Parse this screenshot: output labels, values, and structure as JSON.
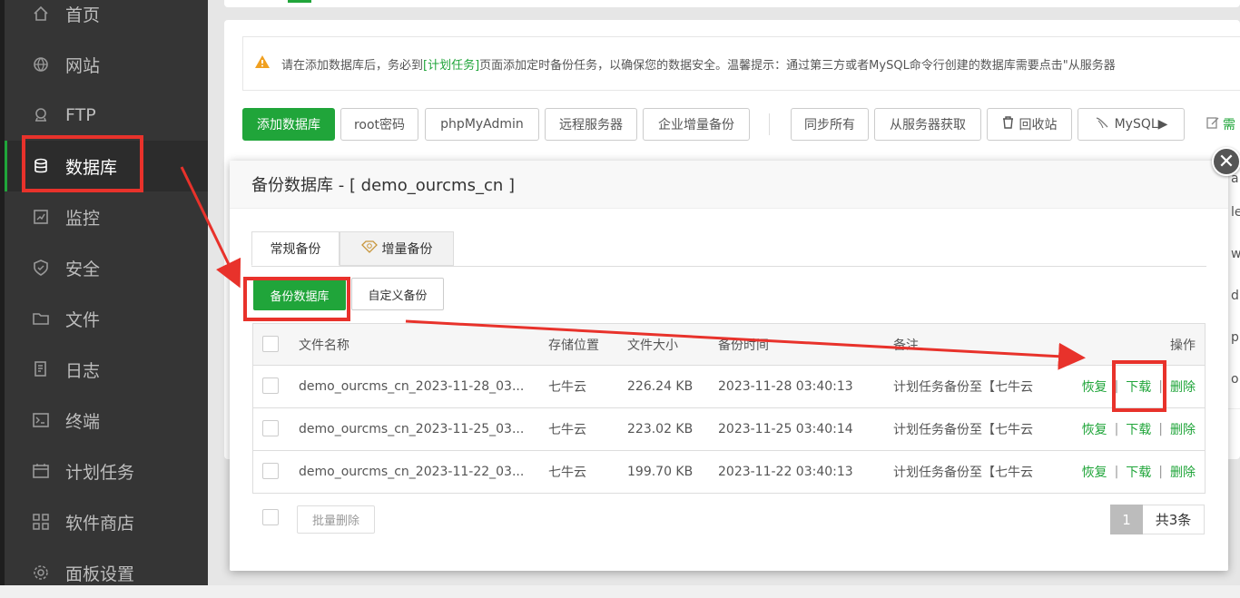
{
  "sidebar": {
    "items": [
      {
        "label": "首页",
        "icon": "home-icon"
      },
      {
        "label": "网站",
        "icon": "globe-icon"
      },
      {
        "label": "FTP",
        "icon": "ftp-icon"
      },
      {
        "label": "数据库",
        "icon": "database-icon",
        "active": true
      },
      {
        "label": "监控",
        "icon": "monitor-icon"
      },
      {
        "label": "安全",
        "icon": "shield-icon"
      },
      {
        "label": "文件",
        "icon": "folder-icon"
      },
      {
        "label": "日志",
        "icon": "log-icon"
      },
      {
        "label": "终端",
        "icon": "terminal-icon"
      },
      {
        "label": "计划任务",
        "icon": "calendar-icon"
      },
      {
        "label": "软件商店",
        "icon": "apps-icon"
      },
      {
        "label": "面板设置",
        "icon": "settings-icon"
      }
    ]
  },
  "notice": {
    "pre": "请在添加数据库后，务必到",
    "link": "[计划任务]",
    "post": "页面添加定时备份任务，以确保您的数据安全。温馨提示：通过第三方或者MySQL命令行创建的数据库需要点击\"从服务器"
  },
  "toolbar": {
    "add_db": "添加数据库",
    "root_pwd": "root密码",
    "phpmyadmin": "phpMyAdmin",
    "remote_server": "远程服务器",
    "enterprise_backup": "企业增量备份",
    "sync_all": "同步所有",
    "fetch_from_server": "从服务器获取",
    "recycle_bin": "回收站",
    "mysql": "MySQL▶",
    "cut_label": "需"
  },
  "bg_column": [
    "a",
    "le",
    "w",
    "d",
    "p",
    "o"
  ],
  "modal": {
    "title": "备份数据库 - [ demo_ourcms_cn ]",
    "tabs": [
      "常规备份",
      "增量备份"
    ],
    "backup_button": "备份数据库",
    "custom_button": "自定义备份",
    "columns": [
      "文件名称",
      "存储位置",
      "文件大小",
      "备份时间",
      "备注",
      "操作"
    ],
    "rows": [
      {
        "name": "demo_ourcms_cn_2023-11-28_03...",
        "storage": "七牛云",
        "size": "226.24 KB",
        "time": "2023-11-28 03:40:13",
        "note": "计划任务备份至【七牛云"
      },
      {
        "name": "demo_ourcms_cn_2023-11-25_03...",
        "storage": "七牛云",
        "size": "223.02 KB",
        "time": "2023-11-25 03:40:14",
        "note": "计划任务备份至【七牛云"
      },
      {
        "name": "demo_ourcms_cn_2023-11-22_03...",
        "storage": "七牛云",
        "size": "199.70 KB",
        "time": "2023-11-22 03:40:13",
        "note": "计划任务备份至【七牛云"
      }
    ],
    "actions": {
      "restore": "恢复",
      "download": "下载",
      "delete": "删除",
      "separator": "|"
    },
    "batch_delete": "批量删除",
    "pager": {
      "current": "1",
      "total": "共3条"
    },
    "close_symbol": "✕"
  },
  "colors": {
    "accent": "#20a53a",
    "sidebar_bg": "#353535",
    "highlight": "#e8322b"
  }
}
